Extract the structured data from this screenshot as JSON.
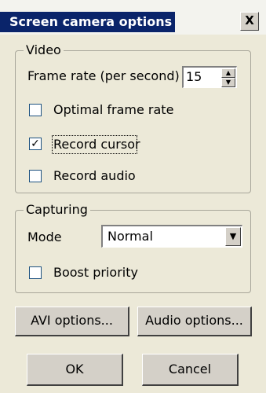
{
  "window": {
    "title": "Screen camera options",
    "close_label": "X"
  },
  "video_group": {
    "label": "Video",
    "frame_rate_label": "Frame rate (per second)",
    "frame_rate_value": "15",
    "spin_up": "▲",
    "spin_down": "▼",
    "optimal_frame_rate": {
      "label": "Optimal frame rate",
      "checked": false,
      "mark": ""
    },
    "record_cursor": {
      "label": "Record cursor",
      "checked": true,
      "mark": "✓"
    },
    "record_audio": {
      "label": "Record audio",
      "checked": false,
      "mark": ""
    }
  },
  "capturing_group": {
    "label": "Capturing",
    "mode_label": "Mode",
    "mode_value": "Normal",
    "dropdown_arrow": "▼",
    "boost_priority": {
      "label": "Boost priority",
      "checked": false,
      "mark": ""
    }
  },
  "buttons": {
    "avi_options": "AVI options...",
    "audio_options": "Audio options...",
    "ok": "OK",
    "cancel": "Cancel"
  },
  "colors": {
    "title_bar": "#0a246a",
    "dialog_face": "#ece9d8",
    "button_face": "#d4d0c8"
  }
}
